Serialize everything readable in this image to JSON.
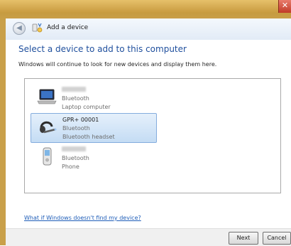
{
  "window": {
    "close_label": "✕",
    "title": "Add a device",
    "back_glyph": "◀"
  },
  "page": {
    "heading": "Select a device to add to this computer",
    "subtitle": "Windows will continue to look for new devices and display them here."
  },
  "devices": [
    {
      "name": "",
      "name_hidden": true,
      "type": "Bluetooth",
      "category": "Laptop computer",
      "icon": "laptop-icon",
      "selected": false
    },
    {
      "name": "GPR+ 00001",
      "name_hidden": false,
      "type": "Bluetooth",
      "category": "Bluetooth headset",
      "icon": "headset-icon",
      "selected": true
    },
    {
      "name": "",
      "name_hidden": true,
      "type": "Bluetooth",
      "category": "Phone",
      "icon": "phone-icon",
      "selected": false
    }
  ],
  "help_link": "What if Windows doesn't find my device?",
  "buttons": {
    "next": "Next",
    "cancel": "Cancel"
  },
  "colors": {
    "heading": "#1f4f9d",
    "link": "#1e5db8",
    "selection": "#c4dcf4"
  }
}
